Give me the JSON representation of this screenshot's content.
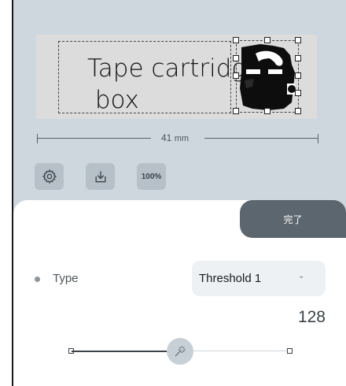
{
  "label": {
    "text_line1": "Tape cartridge",
    "text_line2": " box",
    "width_value": "41",
    "width_unit": "mm"
  },
  "toolbar": {
    "settings_icon": "gear-icon",
    "download_icon": "download-icon",
    "zoom_label": "100%"
  },
  "sheet": {
    "done_label": "完了",
    "type_label": "Type",
    "type_selected": "Threshold 1",
    "threshold_value": "128",
    "slider_fraction": 0.5
  },
  "colors": {
    "editor_bg": "#ced7de",
    "done_bg": "#5b666e",
    "tool_bg": "#b6c0c9"
  }
}
